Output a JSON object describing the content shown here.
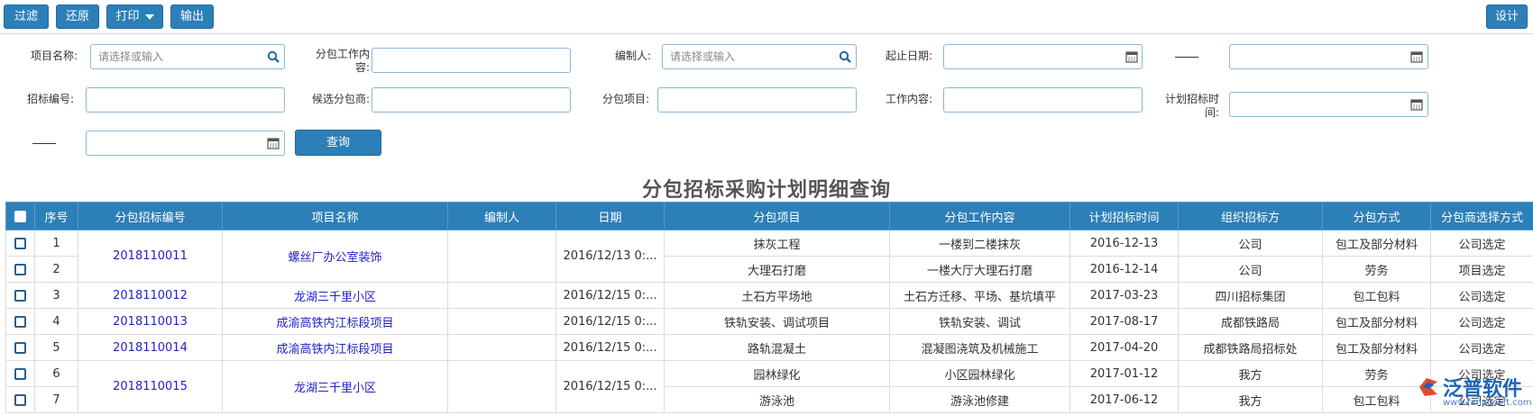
{
  "toolbar": {
    "filter": "过滤",
    "restore": "还原",
    "print": "打印",
    "export": "输出",
    "design": "设计"
  },
  "form": {
    "project_name_label": "项目名称:",
    "project_name_placeholder": "请选择或输入",
    "sub_work_content_label_1": "分包工作内",
    "sub_work_content_label_2": "容:",
    "compiler_label": "编制人:",
    "compiler_placeholder": "请选择或输入",
    "start_date_label": "起止日期:",
    "bid_no_label": "招标编号:",
    "candidate_label": "候选分包商:",
    "sub_project_label": "分包项目:",
    "work_content_label": "工作内容:",
    "plan_time_label_1": "计划招标时",
    "plan_time_label_2": "间:",
    "query": "查询"
  },
  "title": "分包招标采购计划明细查询",
  "table": {
    "headers": [
      "序号",
      "分包招标编号",
      "项目名称",
      "编制人",
      "日期",
      "分包项目",
      "分包工作内容",
      "计划招标时间",
      "组织招标方",
      "分包方式",
      "分包商选择方式"
    ],
    "groups": [
      {
        "bid_no": "2018110011",
        "project": "螺丝厂办公室装饰",
        "compiler": "",
        "date": "2016/12/13 0:...",
        "rows": [
          {
            "seq": "1",
            "item": "抹灰工程",
            "content": "一楼到二楼抹灰",
            "plan": "2016-12-13",
            "org": "公司",
            "mode": "包工及部分材料",
            "select": "公司选定"
          },
          {
            "seq": "2",
            "item": "大理石打磨",
            "content": "一楼大厅大理石打磨",
            "plan": "2016-12-14",
            "org": "公司",
            "mode": "劳务",
            "select": "项目选定"
          }
        ]
      },
      {
        "bid_no": "2018110012",
        "project": "龙湖三千里小区",
        "compiler": "",
        "date": "2016/12/15 0:...",
        "rows": [
          {
            "seq": "3",
            "item": "土石方平场地",
            "content": "土石方迁移、平场、基坑填平",
            "plan": "2017-03-23",
            "org": "四川招标集团",
            "mode": "包工包料",
            "select": "公司选定"
          }
        ]
      },
      {
        "bid_no": "2018110013",
        "project": "成渝高铁内江标段项目",
        "compiler": "",
        "date": "2016/12/15 0:...",
        "rows": [
          {
            "seq": "4",
            "item": "铁轨安装、调试项目",
            "content": "铁轨安装、调试",
            "plan": "2017-08-17",
            "org": "成都铁路局",
            "mode": "包工及部分材料",
            "select": "公司选定"
          }
        ]
      },
      {
        "bid_no": "2018110014",
        "project": "成渝高铁内江标段项目",
        "compiler": "",
        "date": "2016/12/15 0:...",
        "rows": [
          {
            "seq": "5",
            "item": "路轨混凝土",
            "content": "混凝图浇筑及机械施工",
            "plan": "2017-04-20",
            "org": "成都铁路局招标处",
            "mode": "包工及部分材料",
            "select": "公司选定"
          }
        ]
      },
      {
        "bid_no": "2018110015",
        "project": "龙湖三千里小区",
        "compiler": "",
        "date": "2016/12/15 0:...",
        "rows": [
          {
            "seq": "6",
            "item": "园林绿化",
            "content": "小区园林绿化",
            "plan": "2017-01-12",
            "org": "我方",
            "mode": "劳务",
            "select": "公司选定"
          },
          {
            "seq": "7",
            "item": "游泳池",
            "content": "游泳池修建",
            "plan": "2017-06-12",
            "org": "我方",
            "mode": "包工包料",
            "select": "公司选定"
          }
        ]
      }
    ]
  },
  "watermark": {
    "text": "泛普软件",
    "sub": "www.fanpusoft.com"
  },
  "colors": {
    "primary": "#2d7fb8",
    "link": "#2222cc",
    "input_border": "#8cb6d6"
  }
}
